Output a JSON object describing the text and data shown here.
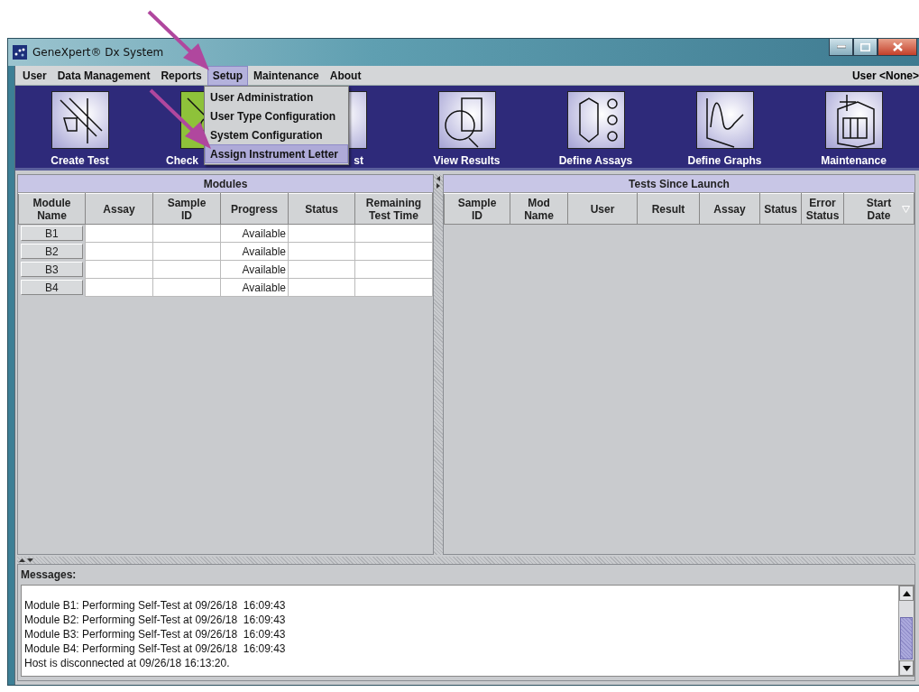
{
  "window": {
    "title": "GeneXpert® Dx System"
  },
  "menu": {
    "items": [
      {
        "label": "User",
        "selected": false
      },
      {
        "label": "Data Management",
        "selected": false
      },
      {
        "label": "Reports",
        "selected": false
      },
      {
        "label": "Setup",
        "selected": true
      },
      {
        "label": "Maintenance",
        "selected": false
      },
      {
        "label": "About",
        "selected": false
      }
    ],
    "user": "User <None>"
  },
  "dropdown": {
    "items": [
      {
        "label": "User Administration",
        "selected": false
      },
      {
        "label": "User Type Configuration",
        "selected": false
      },
      {
        "label": "System Configuration",
        "selected": false
      },
      {
        "label": "Assign Instrument Letter",
        "selected": true
      }
    ]
  },
  "toolbar": [
    {
      "label": "Create Test",
      "kind": "full"
    },
    {
      "label": "Check",
      "kind": "cut_right"
    },
    {
      "label": "st",
      "kind": "cut_left"
    },
    {
      "label": "View Results",
      "kind": "full"
    },
    {
      "label": "Define Assays",
      "kind": "full"
    },
    {
      "label": "Define Graphs",
      "kind": "full"
    },
    {
      "label": "Maintenance",
      "kind": "full"
    }
  ],
  "modules": {
    "title": "Modules",
    "columns": [
      "Module\nName",
      "Assay",
      "Sample\nID",
      "Progress",
      "Status",
      "Remaining\nTest Time"
    ],
    "rows": [
      {
        "module": "B1",
        "progress": "Available"
      },
      {
        "module": "B2",
        "progress": "Available"
      },
      {
        "module": "B3",
        "progress": "Available"
      },
      {
        "module": "B4",
        "progress": "Available"
      }
    ]
  },
  "tests": {
    "title": "Tests Since Launch",
    "columns": [
      {
        "label": "Sample\nID",
        "sorted": false
      },
      {
        "label": "Mod\nName",
        "sorted": false
      },
      {
        "label": "User",
        "sorted": false
      },
      {
        "label": "Result",
        "sorted": false
      },
      {
        "label": "Assay",
        "sorted": false
      },
      {
        "label": "Status",
        "sorted": false
      },
      {
        "label": "Error\nStatus",
        "sorted": false
      },
      {
        "label": "Start\nDate",
        "sorted": true
      }
    ]
  },
  "messages": {
    "title": "Messages:",
    "lines": [
      "Module B1: Performing Self-Test at 09/26/18  16:09:43",
      "Module B2: Performing Self-Test at 09/26/18  16:09:43",
      "Module B3: Performing Self-Test at 09/26/18  16:09:43",
      "Module B4: Performing Self-Test at 09/26/18  16:09:43",
      "Host is disconnected at 09/26/18 16:13:20."
    ]
  }
}
